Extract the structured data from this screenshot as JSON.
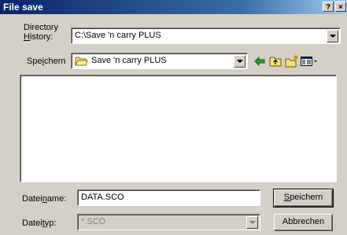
{
  "window": {
    "title": "File save",
    "help_label": "?",
    "close_label": "×"
  },
  "history": {
    "label_line1": "Directory",
    "label_line2_key": "H",
    "label_line2_rest": "istory:",
    "value": "C:\\Save 'n carry PLUS"
  },
  "savein": {
    "label_pre": "Spe",
    "label_key": "i",
    "label_post": "chern",
    "value": "Save 'n carry PLUS"
  },
  "filename": {
    "label_pre": "Datei",
    "label_key": "n",
    "label_post": "ame:",
    "value": "DATA.SCO"
  },
  "filetype": {
    "label_pre": "Datei",
    "label_key": "t",
    "label_post": "yp:",
    "value": "*.SCO"
  },
  "buttons": {
    "save_key": "S",
    "save_rest": "peichern",
    "cancel": "Abbrechen"
  },
  "icons": [
    "help-icon",
    "close-icon",
    "folder-icon",
    "back-icon",
    "up-folder-icon",
    "new-folder-icon",
    "view-menu-icon"
  ],
  "colors": {
    "titlebar_start": "#0a246a",
    "titlebar_end": "#a6caf0",
    "face": "#d4d0c8"
  }
}
